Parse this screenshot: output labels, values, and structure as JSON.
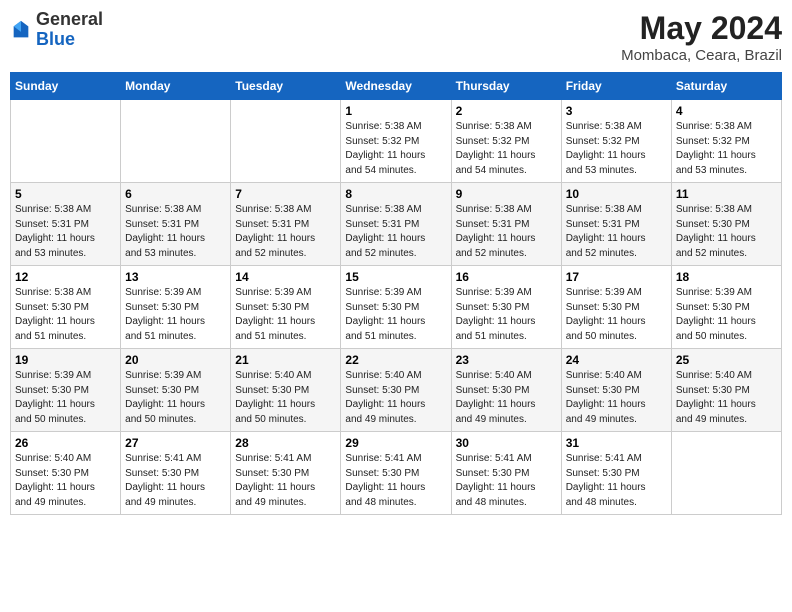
{
  "logo": {
    "general": "General",
    "blue": "Blue"
  },
  "header": {
    "month_title": "May 2024",
    "location": "Mombaca, Ceara, Brazil"
  },
  "days_of_week": [
    "Sunday",
    "Monday",
    "Tuesday",
    "Wednesday",
    "Thursday",
    "Friday",
    "Saturday"
  ],
  "weeks": [
    [
      {
        "day": "",
        "info": ""
      },
      {
        "day": "",
        "info": ""
      },
      {
        "day": "",
        "info": ""
      },
      {
        "day": "1",
        "info": "Sunrise: 5:38 AM\nSunset: 5:32 PM\nDaylight: 11 hours\nand 54 minutes."
      },
      {
        "day": "2",
        "info": "Sunrise: 5:38 AM\nSunset: 5:32 PM\nDaylight: 11 hours\nand 54 minutes."
      },
      {
        "day": "3",
        "info": "Sunrise: 5:38 AM\nSunset: 5:32 PM\nDaylight: 11 hours\nand 53 minutes."
      },
      {
        "day": "4",
        "info": "Sunrise: 5:38 AM\nSunset: 5:32 PM\nDaylight: 11 hours\nand 53 minutes."
      }
    ],
    [
      {
        "day": "5",
        "info": "Sunrise: 5:38 AM\nSunset: 5:31 PM\nDaylight: 11 hours\nand 53 minutes."
      },
      {
        "day": "6",
        "info": "Sunrise: 5:38 AM\nSunset: 5:31 PM\nDaylight: 11 hours\nand 53 minutes."
      },
      {
        "day": "7",
        "info": "Sunrise: 5:38 AM\nSunset: 5:31 PM\nDaylight: 11 hours\nand 52 minutes."
      },
      {
        "day": "8",
        "info": "Sunrise: 5:38 AM\nSunset: 5:31 PM\nDaylight: 11 hours\nand 52 minutes."
      },
      {
        "day": "9",
        "info": "Sunrise: 5:38 AM\nSunset: 5:31 PM\nDaylight: 11 hours\nand 52 minutes."
      },
      {
        "day": "10",
        "info": "Sunrise: 5:38 AM\nSunset: 5:31 PM\nDaylight: 11 hours\nand 52 minutes."
      },
      {
        "day": "11",
        "info": "Sunrise: 5:38 AM\nSunset: 5:30 PM\nDaylight: 11 hours\nand 52 minutes."
      }
    ],
    [
      {
        "day": "12",
        "info": "Sunrise: 5:38 AM\nSunset: 5:30 PM\nDaylight: 11 hours\nand 51 minutes."
      },
      {
        "day": "13",
        "info": "Sunrise: 5:39 AM\nSunset: 5:30 PM\nDaylight: 11 hours\nand 51 minutes."
      },
      {
        "day": "14",
        "info": "Sunrise: 5:39 AM\nSunset: 5:30 PM\nDaylight: 11 hours\nand 51 minutes."
      },
      {
        "day": "15",
        "info": "Sunrise: 5:39 AM\nSunset: 5:30 PM\nDaylight: 11 hours\nand 51 minutes."
      },
      {
        "day": "16",
        "info": "Sunrise: 5:39 AM\nSunset: 5:30 PM\nDaylight: 11 hours\nand 51 minutes."
      },
      {
        "day": "17",
        "info": "Sunrise: 5:39 AM\nSunset: 5:30 PM\nDaylight: 11 hours\nand 50 minutes."
      },
      {
        "day": "18",
        "info": "Sunrise: 5:39 AM\nSunset: 5:30 PM\nDaylight: 11 hours\nand 50 minutes."
      }
    ],
    [
      {
        "day": "19",
        "info": "Sunrise: 5:39 AM\nSunset: 5:30 PM\nDaylight: 11 hours\nand 50 minutes."
      },
      {
        "day": "20",
        "info": "Sunrise: 5:39 AM\nSunset: 5:30 PM\nDaylight: 11 hours\nand 50 minutes."
      },
      {
        "day": "21",
        "info": "Sunrise: 5:40 AM\nSunset: 5:30 PM\nDaylight: 11 hours\nand 50 minutes."
      },
      {
        "day": "22",
        "info": "Sunrise: 5:40 AM\nSunset: 5:30 PM\nDaylight: 11 hours\nand 49 minutes."
      },
      {
        "day": "23",
        "info": "Sunrise: 5:40 AM\nSunset: 5:30 PM\nDaylight: 11 hours\nand 49 minutes."
      },
      {
        "day": "24",
        "info": "Sunrise: 5:40 AM\nSunset: 5:30 PM\nDaylight: 11 hours\nand 49 minutes."
      },
      {
        "day": "25",
        "info": "Sunrise: 5:40 AM\nSunset: 5:30 PM\nDaylight: 11 hours\nand 49 minutes."
      }
    ],
    [
      {
        "day": "26",
        "info": "Sunrise: 5:40 AM\nSunset: 5:30 PM\nDaylight: 11 hours\nand 49 minutes."
      },
      {
        "day": "27",
        "info": "Sunrise: 5:41 AM\nSunset: 5:30 PM\nDaylight: 11 hours\nand 49 minutes."
      },
      {
        "day": "28",
        "info": "Sunrise: 5:41 AM\nSunset: 5:30 PM\nDaylight: 11 hours\nand 49 minutes."
      },
      {
        "day": "29",
        "info": "Sunrise: 5:41 AM\nSunset: 5:30 PM\nDaylight: 11 hours\nand 48 minutes."
      },
      {
        "day": "30",
        "info": "Sunrise: 5:41 AM\nSunset: 5:30 PM\nDaylight: 11 hours\nand 48 minutes."
      },
      {
        "day": "31",
        "info": "Sunrise: 5:41 AM\nSunset: 5:30 PM\nDaylight: 11 hours\nand 48 minutes."
      },
      {
        "day": "",
        "info": ""
      }
    ]
  ]
}
